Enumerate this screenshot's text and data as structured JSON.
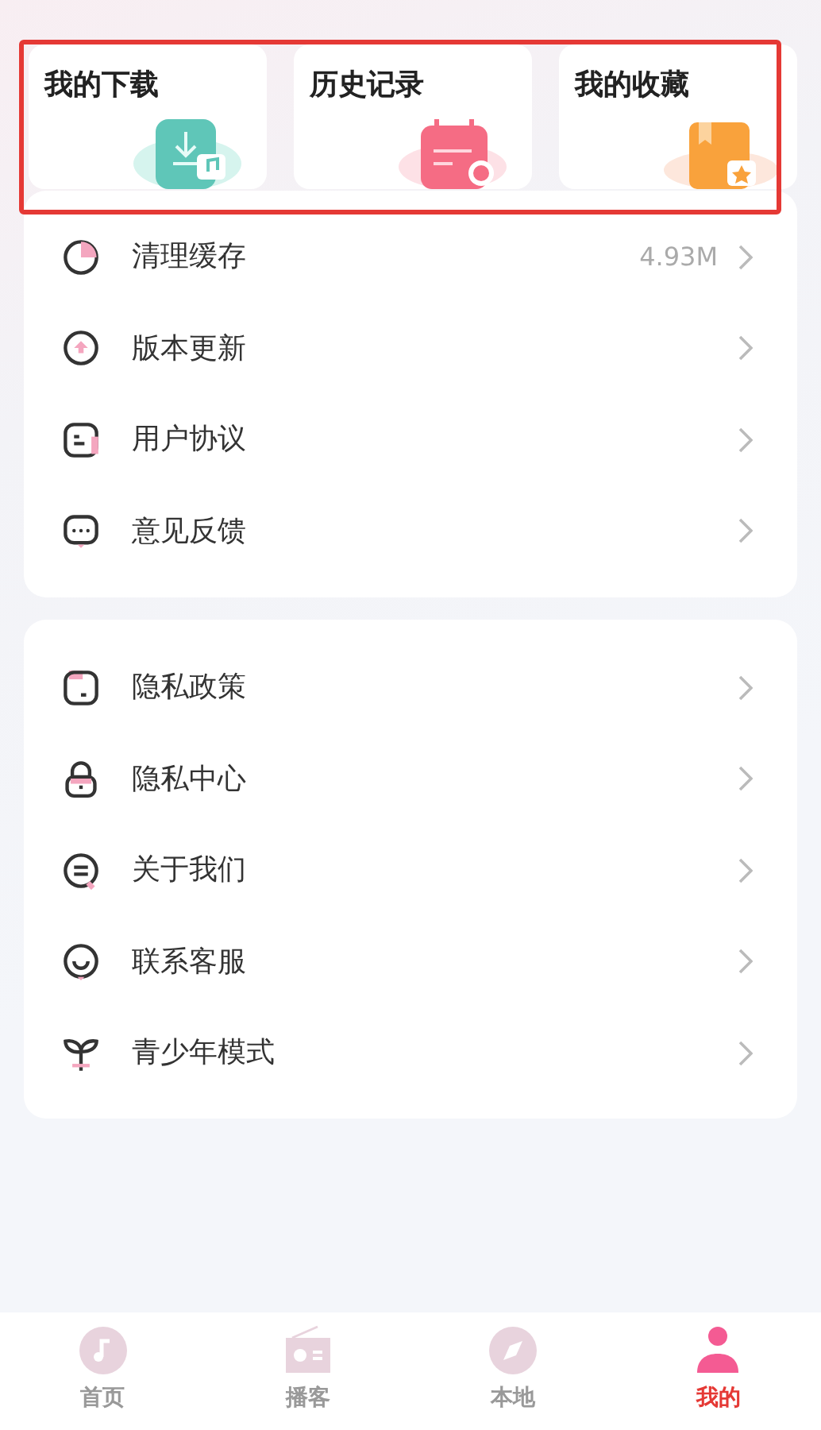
{
  "shortcuts": [
    {
      "label": "我的下载",
      "kind": "download"
    },
    {
      "label": "历史记录",
      "kind": "history"
    },
    {
      "label": "我的收藏",
      "kind": "favorite"
    }
  ],
  "groups": [
    {
      "items": [
        {
          "label": "清理缓存",
          "kind": "cache",
          "value": "4.93M"
        },
        {
          "label": "版本更新",
          "kind": "update"
        },
        {
          "label": "用户协议",
          "kind": "agreement"
        },
        {
          "label": "意见反馈",
          "kind": "feedback"
        }
      ]
    },
    {
      "items": [
        {
          "label": "隐私政策",
          "kind": "policy"
        },
        {
          "label": "隐私中心",
          "kind": "lock"
        },
        {
          "label": "关于我们",
          "kind": "about"
        },
        {
          "label": "联系客服",
          "kind": "service"
        },
        {
          "label": "青少年模式",
          "kind": "youth"
        }
      ]
    }
  ],
  "tabbar": [
    {
      "label": "首页",
      "kind": "home",
      "selected": false
    },
    {
      "label": "播客",
      "kind": "podcast",
      "selected": false
    },
    {
      "label": "本地",
      "kind": "local",
      "selected": false
    },
    {
      "label": "我的",
      "kind": "mine",
      "selected": true
    }
  ]
}
